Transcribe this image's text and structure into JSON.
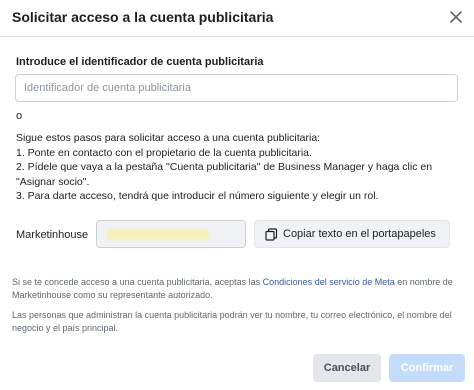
{
  "dialog": {
    "title": "Solicitar acceso a la cuenta publicitaria"
  },
  "ad_account": {
    "field_label": "Introduce el identificador de cuenta publicitaria",
    "placeholder": "Identificador de cuenta publicitaria",
    "value": ""
  },
  "or_text": "o",
  "instructions": {
    "intro": "Sigue estos pasos para solicitar acceso a una cuenta publicitaria:",
    "step1": "1. Ponte en contacto con el propietario de la cuenta publicitaria.",
    "step2a": "2. Pídele que vaya a la pestaña \"Cuenta publicitaria\" de Business Manager y haga clic en",
    "step2b": "\"Asignar socio\".",
    "step3": "3. Para darte acceso, tendrá que introducir el número siguiente y elegir un rol."
  },
  "business": {
    "name": "Marketinhouse",
    "copy_button": "Copiar texto en el portapapeles"
  },
  "legal": {
    "p1_before": "Si se te concede acceso a una cuenta publicitaria, aceptas las ",
    "p1_link": "Condiciones del servicio de Meta",
    "p1_after": " en nombre de Marketinhouse como su representante autorizado.",
    "p2": "Las personas que administran la cuenta publicitaria podrán ver tu nombre, tu correo electrónico, el nombre del negocio y el país principal."
  },
  "footer": {
    "cancel": "Cancelar",
    "confirm": "Confirmar"
  },
  "colors": {
    "link": "#385898",
    "confirm_disabled": "#c4dcfb",
    "cancel_bg": "#e4e6eb"
  }
}
